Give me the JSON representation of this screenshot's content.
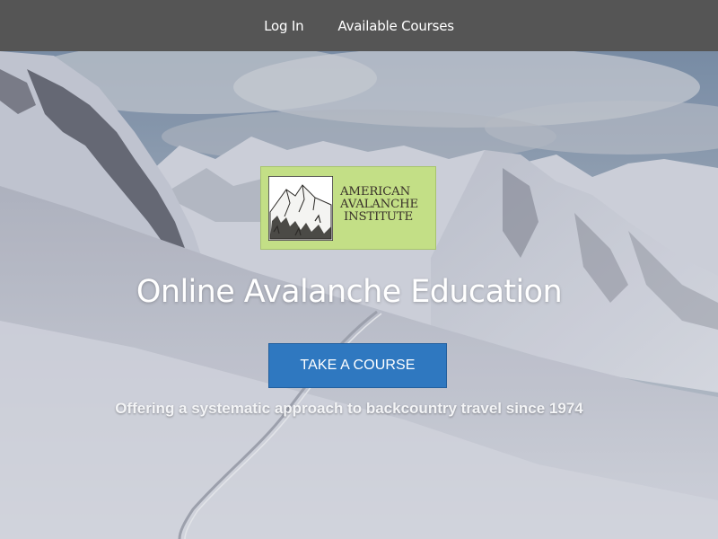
{
  "nav": {
    "login_label": "Log In",
    "courses_label": "Available Courses"
  },
  "logo": {
    "line1": "AMERICAN",
    "line2": "AVALANCHE",
    "line3": "INSTITUTE"
  },
  "hero": {
    "title": "Online Avalanche Education",
    "cta_label": "TAKE A COURSE",
    "tagline": "Offering a systematic approach to backcountry travel since 1974"
  },
  "colors": {
    "nav_bg": "#555555",
    "cta_bg": "#2f78c0",
    "logo_bg": "#c3df86"
  }
}
